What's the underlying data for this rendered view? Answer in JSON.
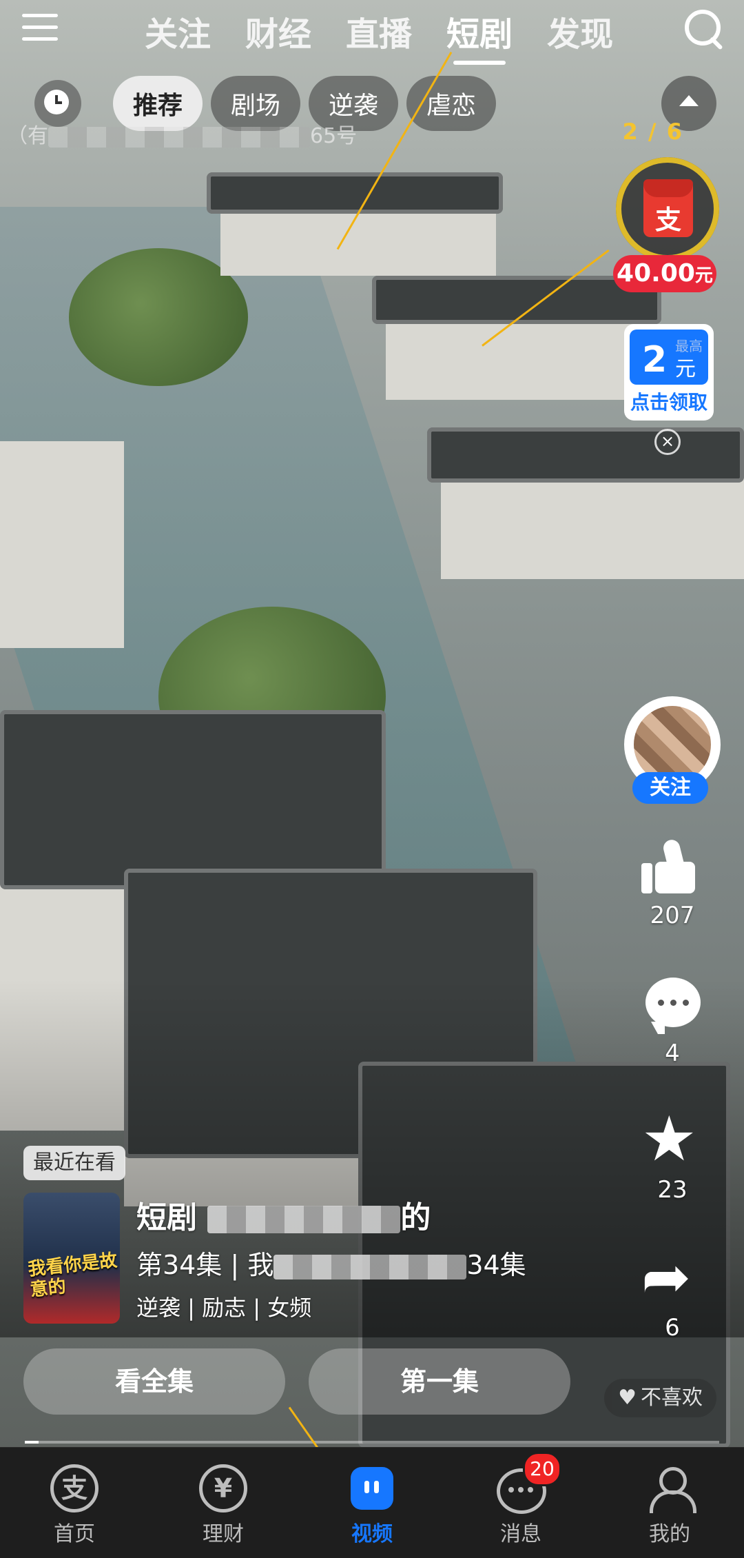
{
  "topbar": {
    "tabs": [
      "关注",
      "财经",
      "直播",
      "短剧",
      "发现"
    ],
    "active_tab": "短剧"
  },
  "chips": {
    "items": [
      "推荐",
      "剧场",
      "逆袭",
      "虐恋"
    ],
    "active": "推荐"
  },
  "address_text": "（有",
  "address_text_end": "65号",
  "reward": {
    "progress": "2 / 6",
    "amount": "40.00",
    "currency": "元",
    "icon_glyph": "支"
  },
  "coupon": {
    "tag": "最高",
    "value": "2",
    "unit": "元",
    "cta": "点击领取"
  },
  "creator": {
    "follow_label": "关注"
  },
  "actions": {
    "likes": "207",
    "comments": "4",
    "favorites": "23",
    "shares": "6"
  },
  "drama": {
    "recent_tag": "最近在看",
    "poster_text": "我看你是故意的",
    "title_prefix": "短剧",
    "title_suffix": "的",
    "episode_prefix": "第34集 | 我",
    "episode_suffix": "34集",
    "genres": "逆袭 | 励志 | 女频",
    "watch_all": "看全集",
    "first_ep": "第一集",
    "dislike": "不喜欢",
    "playback_progress": 0.02
  },
  "tabbar": {
    "items": [
      {
        "label": "首页",
        "icon": "alipay-home-icon",
        "glyph": "支"
      },
      {
        "label": "理财",
        "icon": "wealth-icon",
        "glyph": "¥"
      },
      {
        "label": "视频",
        "icon": "video-icon"
      },
      {
        "label": "消息",
        "icon": "message-icon",
        "badge": "20"
      },
      {
        "label": "我的",
        "icon": "profile-icon"
      }
    ],
    "active": "视频"
  },
  "colors": {
    "accent": "#1677ff",
    "reward_red": "#e8283a",
    "progress_gold": "#f4c430",
    "badge_red": "#f02424"
  }
}
